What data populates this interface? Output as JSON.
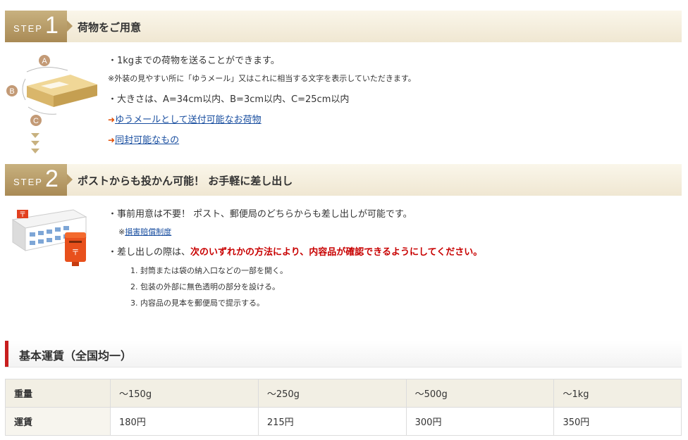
{
  "step1": {
    "word": "STEP",
    "number": "1",
    "title": "荷物をご用意",
    "illustration_labels": [
      "A",
      "B",
      "C"
    ],
    "bullet1": "・1kgまでの荷物を送ることができます。",
    "note": "※外装の見やすい所に「ゆうメール」又はこれに相当する文字を表示していただきます。",
    "bullet2": "・大きさは、A=34cm以内、B=3cm以内、C=25cm以内",
    "link1": "ゆうメールとして送付可能なお荷物",
    "link2": "同封可能なもの"
  },
  "step2": {
    "word": "STEP",
    "number": "2",
    "title": "ポストからも投かん可能！ お手軽に差し出し",
    "bullet1": "・事前用意は不要！ ポスト、郵便局のどちらからも差し出しが可能です。",
    "note_prefix": "※",
    "note_link": "損害賠償制度",
    "bullet2_prefix": "・差し出しの際は、",
    "bullet2_emphasis": "次のいずれかの方法により、内容品が確認できるようにしてください。",
    "methods": [
      "1. 封筒または袋の納入口などの一部を開く。",
      "2. 包装の外部に無色透明の部分を設ける。",
      "3. 内容品の見本を郵便局で提示する。"
    ]
  },
  "rates": {
    "title": "基本運賃（全国均一）",
    "header": [
      "重量",
      "～150g",
      "～250g",
      "～500g",
      "～1kg"
    ],
    "row": [
      "運賃",
      "180円",
      "215円",
      "300円",
      "350円"
    ]
  },
  "colors": {
    "accent_red": "#c80000",
    "step_badge": "#b69a66",
    "link_blue": "#1a4fa0",
    "arrow_orange": "#e04a00"
  }
}
